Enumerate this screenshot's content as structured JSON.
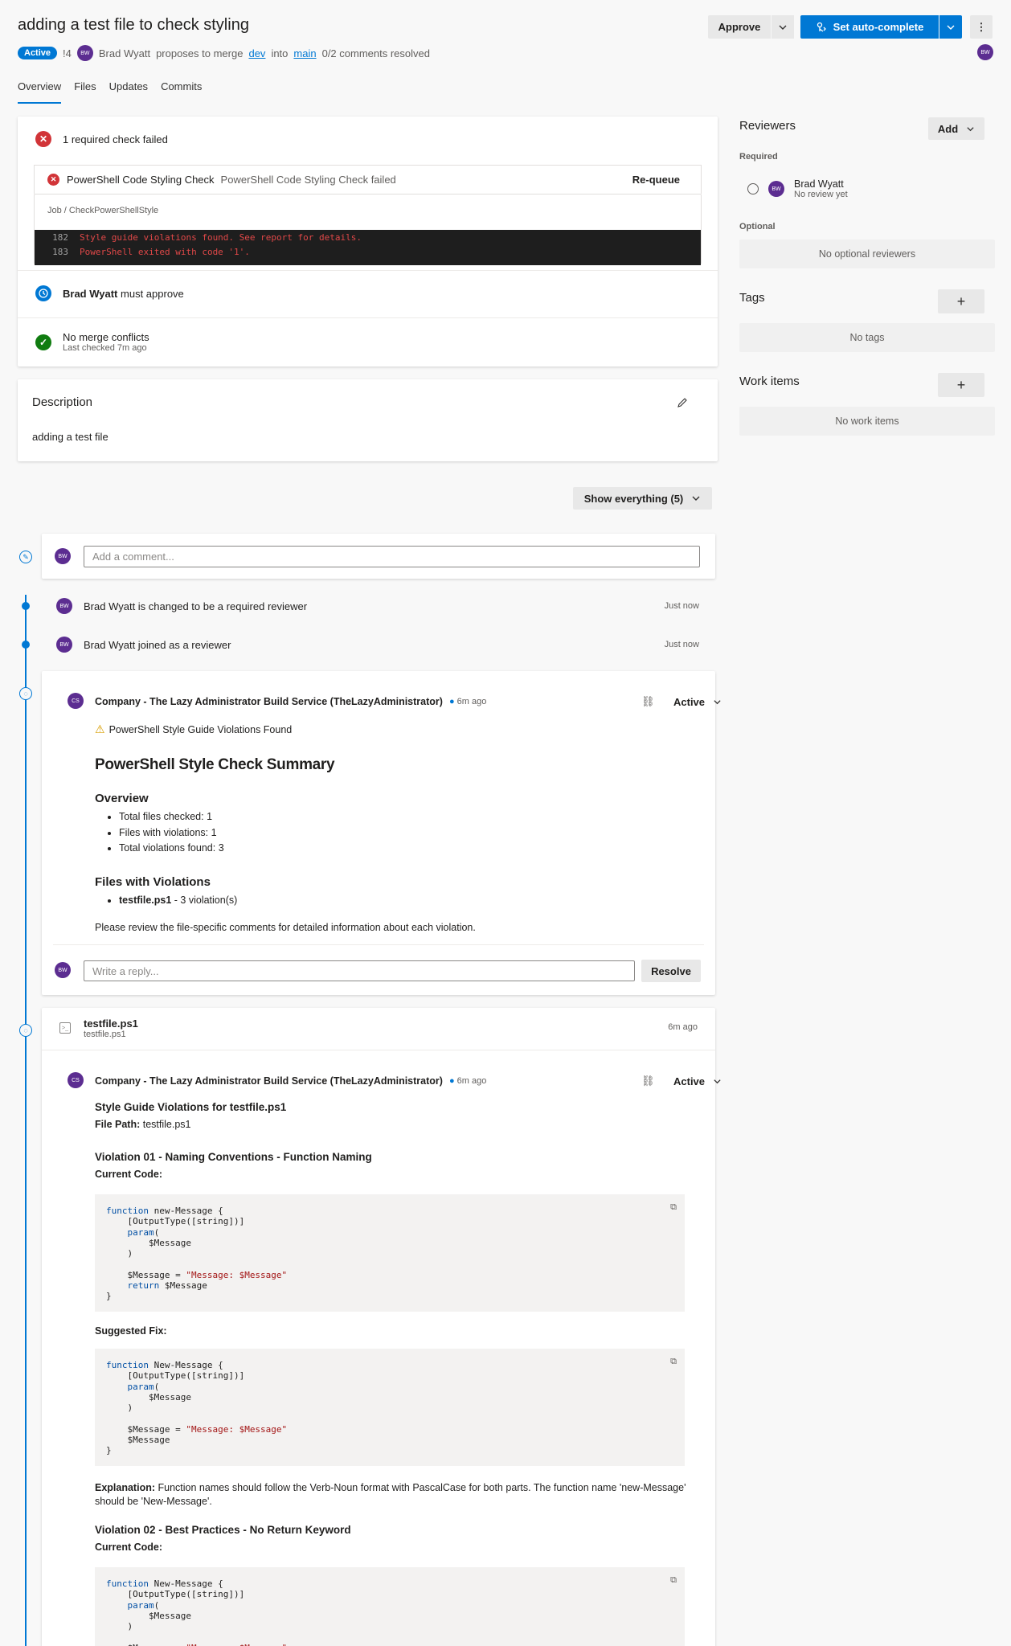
{
  "header": {
    "title": "adding a test file to check styling",
    "status": "Active",
    "pr_id": "!4",
    "author_initials": "BW",
    "author": "Brad Wyatt",
    "proposes_text": "proposes to merge",
    "source_branch": "dev",
    "into_text": "into",
    "target_branch": "main",
    "comments_resolved": "0/2 comments resolved",
    "approve_label": "Approve",
    "autocomplete_label": "Set auto-complete",
    "more_label": "⋮"
  },
  "tabs": [
    "Overview",
    "Files",
    "Updates",
    "Commits"
  ],
  "checks": {
    "summary": "1 required check failed",
    "check_name": "PowerShell Code Styling Check",
    "check_status": "PowerShell Code Styling Check failed",
    "requeue_label": "Re-queue",
    "job_path": "Job / CheckPowerShellStyle",
    "log": [
      {
        "num": "182",
        "text": "Style guide violations found. See report for details."
      },
      {
        "num": "183",
        "text": "PowerShell exited with code '1'."
      }
    ],
    "approver_name": "Brad Wyatt",
    "approver_suffix": "must approve",
    "merge_title": "No merge conflicts",
    "merge_sub": "Last checked 7m ago"
  },
  "description": {
    "heading": "Description",
    "text": "adding a test file"
  },
  "show_everything": "Show everything (5)",
  "comment_placeholder": "Add a comment...",
  "events": [
    {
      "text": "Brad Wyatt is changed to be a required reviewer",
      "time": "Just now"
    },
    {
      "text": "Brad Wyatt joined as a reviewer",
      "time": "Just now"
    }
  ],
  "thread1": {
    "author_initials": "CS",
    "author": "Company - The Lazy Administrator Build Service (TheLazyAdministrator)",
    "time": "6m ago",
    "status": "Active",
    "warning": "PowerShell Style Guide Violations Found",
    "summary_heading": "PowerShell Style Check Summary",
    "overview_heading": "Overview",
    "overview_items": [
      "Total files checked: 1",
      "Files with violations: 1",
      "Total violations found: 3"
    ],
    "files_heading": "Files with Violations",
    "file_name": "testfile.ps1",
    "file_violations": " - 3 violation(s)",
    "review_text": "Please review the file-specific comments for detailed information about each violation.",
    "reply_placeholder": "Write a reply...",
    "resolve_label": "Resolve"
  },
  "thread2": {
    "file_title": "testfile.ps1",
    "file_sub": "testfile.ps1",
    "file_time": "6m ago",
    "author_initials": "CS",
    "author": "Company - The Lazy Administrator Build Service (TheLazyAdministrator)",
    "time": "6m ago",
    "status": "Active",
    "heading": "Style Guide Violations for testfile.ps1",
    "file_path_label": "File Path:",
    "file_path": "testfile.ps1",
    "v1_heading": "Violation 01 - Naming Conventions - Function Naming",
    "current_code_label": "Current Code:",
    "suggested_fix_label": "Suggested Fix:",
    "explanation_label": "Explanation:",
    "explanation": "Function names should follow the Verb-Noun format with PascalCase for both parts. The function name 'new-Message' should be 'New-Message'.",
    "v2_heading": "Violation 02 - Best Practices - No Return Keyword",
    "current_code_label_2": "Current Code:"
  },
  "sidebar": {
    "reviewers_heading": "Reviewers",
    "add_label": "Add",
    "required_label": "Required",
    "reviewer_initials": "BW",
    "reviewer_name": "Brad Wyatt",
    "reviewer_status": "No review yet",
    "optional_label": "Optional",
    "no_optional": "No optional reviewers",
    "tags_heading": "Tags",
    "no_tags": "No tags",
    "work_items_heading": "Work items",
    "no_work_items": "No work items"
  }
}
